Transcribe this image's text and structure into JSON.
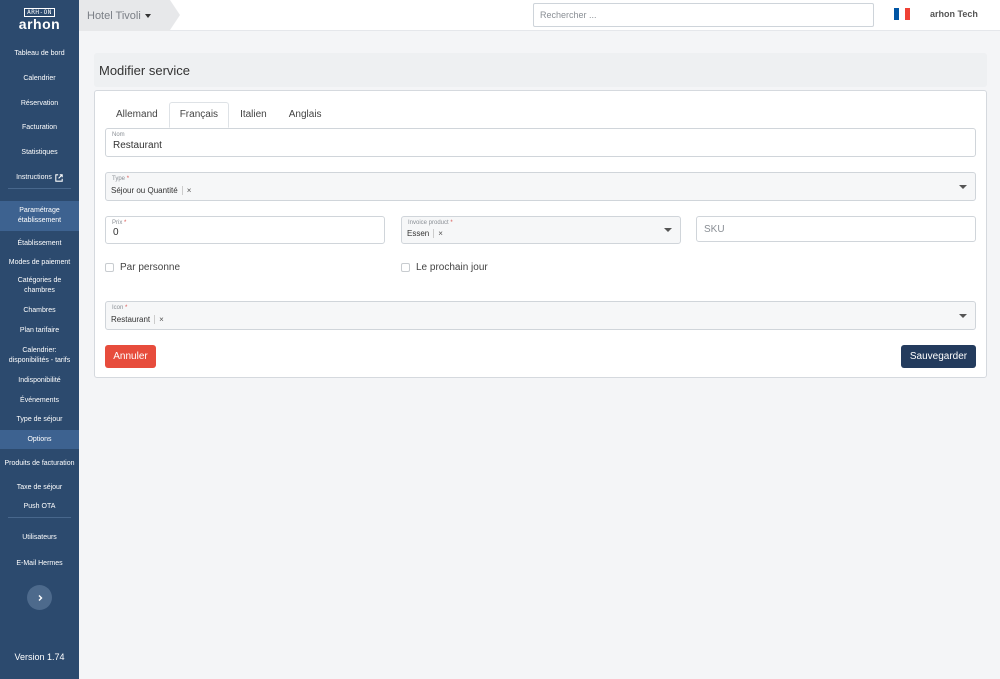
{
  "app": {
    "logo_top": "ARH-ON",
    "logo_main": "arhon",
    "version": "Version 1.74"
  },
  "sidebar": {
    "items": [
      {
        "label": "Tableau de bord"
      },
      {
        "label": "Calendrier"
      },
      {
        "label": "Réservation"
      },
      {
        "label": "Facturation"
      },
      {
        "label": "Statistiques"
      },
      {
        "label": "Instructions"
      },
      {
        "label": "Paramétrage établissement"
      },
      {
        "label": "Établissement"
      },
      {
        "label": "Modes de paiement"
      },
      {
        "label": "Catégories de chambres"
      },
      {
        "label": "Chambres"
      },
      {
        "label": "Plan tarifaire"
      },
      {
        "label": "Calendrier: disponibilités - tarifs"
      },
      {
        "label": "Indisponibilité"
      },
      {
        "label": "Événements"
      },
      {
        "label": "Type de séjour"
      },
      {
        "label": "Options"
      },
      {
        "label": "Produits de facturation"
      },
      {
        "label": "Taxe de séjour"
      },
      {
        "label": "Push OTA"
      },
      {
        "label": "Utilisateurs"
      },
      {
        "label": "E-Mail Hermes"
      }
    ]
  },
  "topbar": {
    "hotel": "Hotel Tivoli",
    "search_placeholder": "Rechercher ...",
    "user": "arhon Tech",
    "flag_colors": [
      "#0055a4",
      "#ffffff",
      "#ef4135"
    ]
  },
  "page": {
    "title": "Modifier service"
  },
  "tabs": [
    "Allemand",
    "Français",
    "Italien",
    "Anglais"
  ],
  "form": {
    "nom_label": "Nom",
    "nom_value": "Restaurant",
    "type_label": "Type",
    "type_value": "Séjour ou Quantité",
    "prix_label": "Prix",
    "prix_value": "0",
    "invoice_label": "Invoice product",
    "invoice_value": "Essen",
    "sku_placeholder": "SKU",
    "par_personne": "Par personne",
    "prochain_jour": "Le prochain jour",
    "icon_label": "Icon",
    "icon_value": "Restaurant",
    "required_mark": "*",
    "clear": "×"
  },
  "buttons": {
    "cancel": "Annuler",
    "save": "Sauvegarder"
  },
  "colors": {
    "sidebar": "#2c4a6e",
    "cancel": "#e74c3c",
    "save": "#233b5d"
  }
}
